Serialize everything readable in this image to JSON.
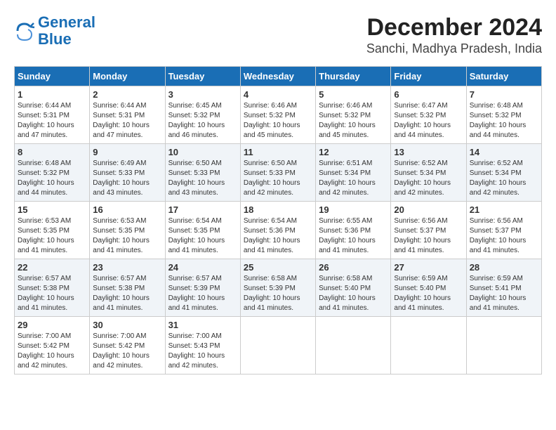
{
  "logo": {
    "line1": "General",
    "line2": "Blue"
  },
  "title": "December 2024",
  "location": "Sanchi, Madhya Pradesh, India",
  "weekdays": [
    "Sunday",
    "Monday",
    "Tuesday",
    "Wednesday",
    "Thursday",
    "Friday",
    "Saturday"
  ],
  "weeks": [
    [
      {
        "day": "1",
        "sunrise": "6:44 AM",
        "sunset": "5:31 PM",
        "daylight": "10 hours and 47 minutes."
      },
      {
        "day": "2",
        "sunrise": "6:44 AM",
        "sunset": "5:31 PM",
        "daylight": "10 hours and 47 minutes."
      },
      {
        "day": "3",
        "sunrise": "6:45 AM",
        "sunset": "5:32 PM",
        "daylight": "10 hours and 46 minutes."
      },
      {
        "day": "4",
        "sunrise": "6:46 AM",
        "sunset": "5:32 PM",
        "daylight": "10 hours and 45 minutes."
      },
      {
        "day": "5",
        "sunrise": "6:46 AM",
        "sunset": "5:32 PM",
        "daylight": "10 hours and 45 minutes."
      },
      {
        "day": "6",
        "sunrise": "6:47 AM",
        "sunset": "5:32 PM",
        "daylight": "10 hours and 44 minutes."
      },
      {
        "day": "7",
        "sunrise": "6:48 AM",
        "sunset": "5:32 PM",
        "daylight": "10 hours and 44 minutes."
      }
    ],
    [
      {
        "day": "8",
        "sunrise": "6:48 AM",
        "sunset": "5:32 PM",
        "daylight": "10 hours and 44 minutes."
      },
      {
        "day": "9",
        "sunrise": "6:49 AM",
        "sunset": "5:33 PM",
        "daylight": "10 hours and 43 minutes."
      },
      {
        "day": "10",
        "sunrise": "6:50 AM",
        "sunset": "5:33 PM",
        "daylight": "10 hours and 43 minutes."
      },
      {
        "day": "11",
        "sunrise": "6:50 AM",
        "sunset": "5:33 PM",
        "daylight": "10 hours and 42 minutes."
      },
      {
        "day": "12",
        "sunrise": "6:51 AM",
        "sunset": "5:34 PM",
        "daylight": "10 hours and 42 minutes."
      },
      {
        "day": "13",
        "sunrise": "6:52 AM",
        "sunset": "5:34 PM",
        "daylight": "10 hours and 42 minutes."
      },
      {
        "day": "14",
        "sunrise": "6:52 AM",
        "sunset": "5:34 PM",
        "daylight": "10 hours and 42 minutes."
      }
    ],
    [
      {
        "day": "15",
        "sunrise": "6:53 AM",
        "sunset": "5:35 PM",
        "daylight": "10 hours and 41 minutes."
      },
      {
        "day": "16",
        "sunrise": "6:53 AM",
        "sunset": "5:35 PM",
        "daylight": "10 hours and 41 minutes."
      },
      {
        "day": "17",
        "sunrise": "6:54 AM",
        "sunset": "5:35 PM",
        "daylight": "10 hours and 41 minutes."
      },
      {
        "day": "18",
        "sunrise": "6:54 AM",
        "sunset": "5:36 PM",
        "daylight": "10 hours and 41 minutes."
      },
      {
        "day": "19",
        "sunrise": "6:55 AM",
        "sunset": "5:36 PM",
        "daylight": "10 hours and 41 minutes."
      },
      {
        "day": "20",
        "sunrise": "6:56 AM",
        "sunset": "5:37 PM",
        "daylight": "10 hours and 41 minutes."
      },
      {
        "day": "21",
        "sunrise": "6:56 AM",
        "sunset": "5:37 PM",
        "daylight": "10 hours and 41 minutes."
      }
    ],
    [
      {
        "day": "22",
        "sunrise": "6:57 AM",
        "sunset": "5:38 PM",
        "daylight": "10 hours and 41 minutes."
      },
      {
        "day": "23",
        "sunrise": "6:57 AM",
        "sunset": "5:38 PM",
        "daylight": "10 hours and 41 minutes."
      },
      {
        "day": "24",
        "sunrise": "6:57 AM",
        "sunset": "5:39 PM",
        "daylight": "10 hours and 41 minutes."
      },
      {
        "day": "25",
        "sunrise": "6:58 AM",
        "sunset": "5:39 PM",
        "daylight": "10 hours and 41 minutes."
      },
      {
        "day": "26",
        "sunrise": "6:58 AM",
        "sunset": "5:40 PM",
        "daylight": "10 hours and 41 minutes."
      },
      {
        "day": "27",
        "sunrise": "6:59 AM",
        "sunset": "5:40 PM",
        "daylight": "10 hours and 41 minutes."
      },
      {
        "day": "28",
        "sunrise": "6:59 AM",
        "sunset": "5:41 PM",
        "daylight": "10 hours and 41 minutes."
      }
    ],
    [
      {
        "day": "29",
        "sunrise": "7:00 AM",
        "sunset": "5:42 PM",
        "daylight": "10 hours and 42 minutes."
      },
      {
        "day": "30",
        "sunrise": "7:00 AM",
        "sunset": "5:42 PM",
        "daylight": "10 hours and 42 minutes."
      },
      {
        "day": "31",
        "sunrise": "7:00 AM",
        "sunset": "5:43 PM",
        "daylight": "10 hours and 42 minutes."
      },
      {
        "day": "",
        "sunrise": "",
        "sunset": "",
        "daylight": ""
      },
      {
        "day": "",
        "sunrise": "",
        "sunset": "",
        "daylight": ""
      },
      {
        "day": "",
        "sunrise": "",
        "sunset": "",
        "daylight": ""
      },
      {
        "day": "",
        "sunrise": "",
        "sunset": "",
        "daylight": ""
      }
    ]
  ],
  "labels": {
    "sunrise_prefix": "Sunrise:",
    "sunset_prefix": "Sunset:",
    "daylight_prefix": "Daylight:"
  }
}
